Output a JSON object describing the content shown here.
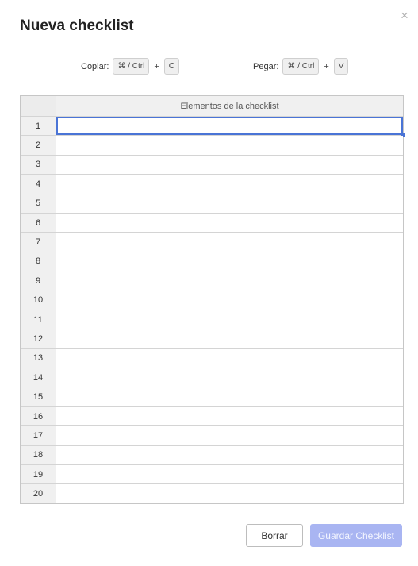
{
  "dialog": {
    "title": "Nueva checklist",
    "close_icon": "×"
  },
  "shortcuts": {
    "copy": {
      "label": "Copiar:",
      "modifier": "⌘ / Ctrl",
      "plus": "+",
      "key": "C"
    },
    "paste": {
      "label": "Pegar:",
      "modifier": "⌘ / Ctrl",
      "plus": "+",
      "key": "V"
    }
  },
  "grid": {
    "column_header": "Elementos de la checklist",
    "rows": [
      "1",
      "2",
      "3",
      "4",
      "5",
      "6",
      "7",
      "8",
      "9",
      "10",
      "11",
      "12",
      "13",
      "14",
      "15",
      "16",
      "17",
      "18",
      "19",
      "20"
    ],
    "selected_row": 1,
    "selection_color": "#4a74d6"
  },
  "buttons": {
    "clear": "Borrar",
    "save": "Guardar Checklist",
    "save_color": "#a9b5f2"
  }
}
